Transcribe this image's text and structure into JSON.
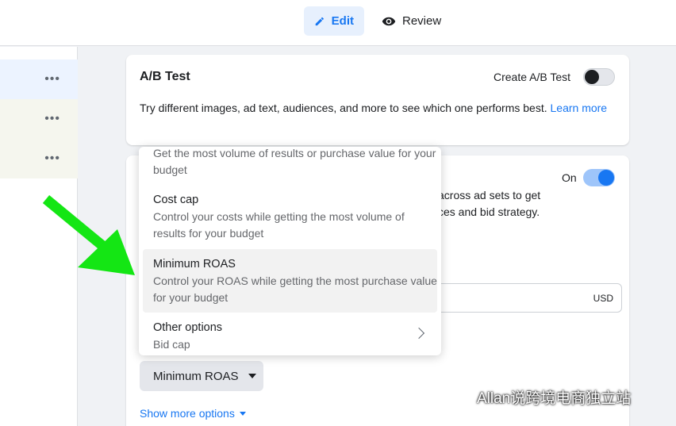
{
  "header": {
    "edit_label": "Edit",
    "review_label": "Review"
  },
  "icons": {
    "edit": "pencil-icon",
    "review": "eye-icon",
    "row_menu": "more-dots-icon",
    "submenu": "chevron-right-icon",
    "dropdown": "caret-down-icon"
  },
  "sidebar": {
    "rows": [
      {
        "dots": "•••"
      },
      {
        "dots": "•••"
      },
      {
        "dots": "•••"
      }
    ]
  },
  "ab_test": {
    "title": "A/B Test",
    "toggle_label": "Create A/B Test",
    "toggle_on": false,
    "description": "Try different images, ad text, audiences, and more to see which one performs best.",
    "learn_more": "Learn more"
  },
  "budget": {
    "toggle_label": "On",
    "toggle_on": true,
    "description_line1": "across ad sets to get",
    "description_line2": "ces and bid strategy.",
    "currency": "USD",
    "bid_strategy_value": "Minimum ROAS",
    "show_more_label": "Show more options"
  },
  "dropdown": {
    "options": [
      {
        "title": "",
        "description": "Get the most volume of results or purchase value for your budget"
      },
      {
        "title": "Cost cap",
        "description": "Control your costs while getting the most volume of results for your budget"
      },
      {
        "title": "Minimum ROAS",
        "description": "Control your ROAS while getting the most purchase value for your budget",
        "selected": true
      },
      {
        "title": "Other options",
        "description": "Bid cap",
        "has_submenu": true
      }
    ]
  },
  "overlay": {
    "arrow_color": "#14e614"
  },
  "watermark": {
    "text": "Allan说跨境电商独立站"
  },
  "colors": {
    "accent": "#1877f2",
    "selected_bg": "#f2f2f2"
  }
}
